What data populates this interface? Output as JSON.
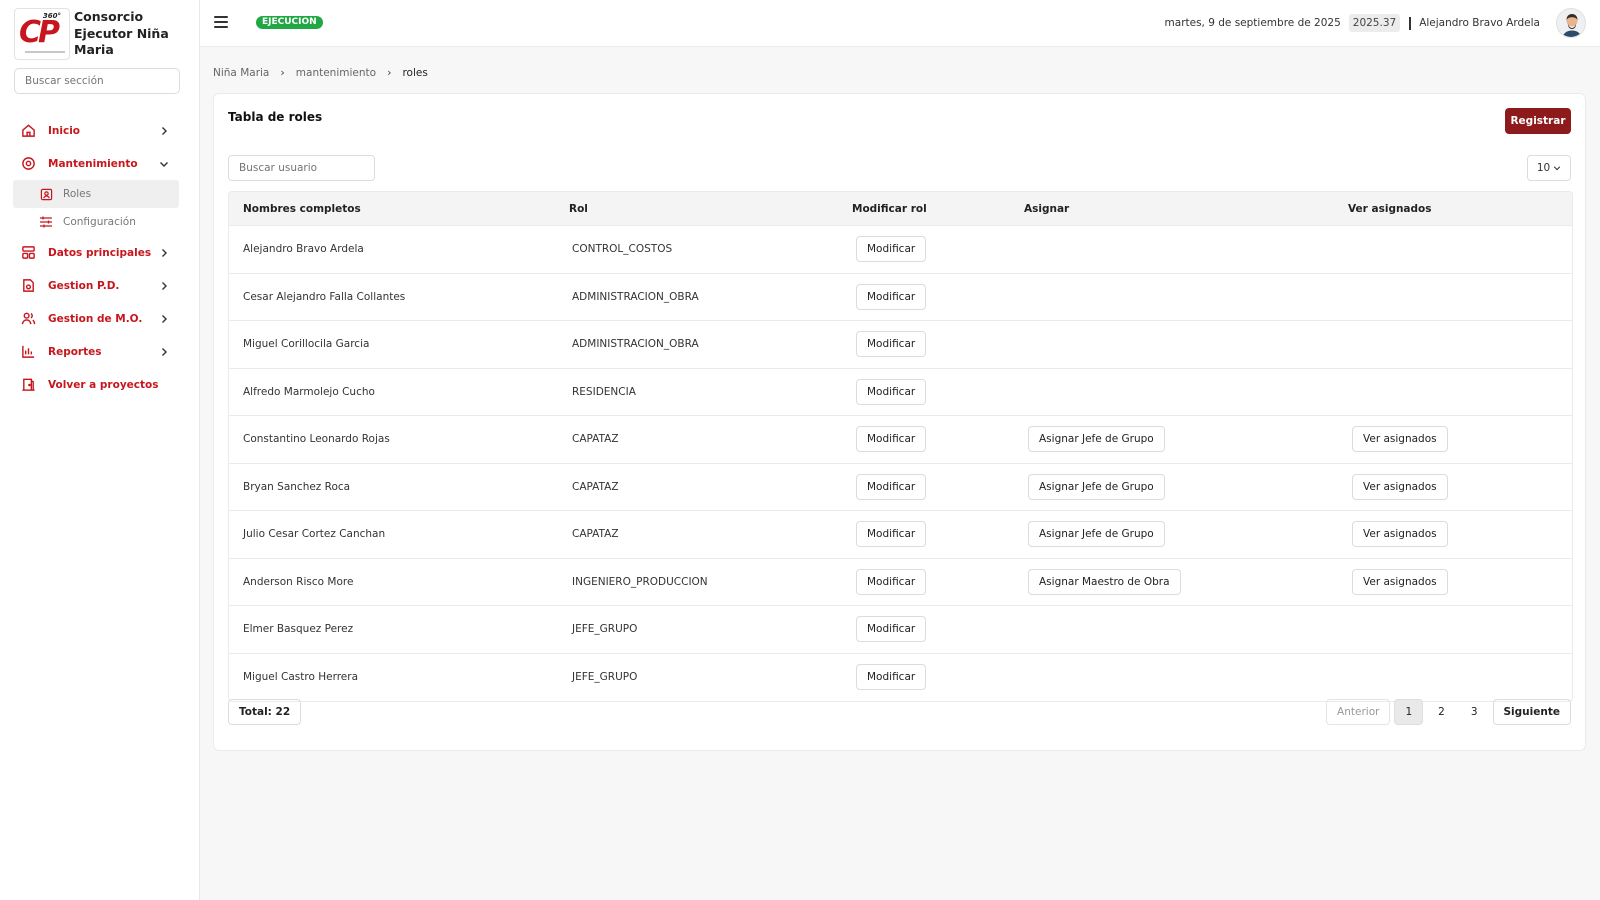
{
  "brand": {
    "name_line1": "Consorcio",
    "name_line2": "Ejecutor Niña",
    "name_line3": "Maria",
    "logo_text": "CP",
    "logo_badge": "360°"
  },
  "sidebar": {
    "search_placeholder": "Buscar sección",
    "items": [
      {
        "label": "Inicio",
        "icon": "home-icon",
        "chevron": "right"
      },
      {
        "label": "Mantenimiento",
        "icon": "settings-circle-icon",
        "chevron": "down"
      },
      {
        "label": "Datos principales",
        "icon": "layout-icon",
        "chevron": "right"
      },
      {
        "label": "Gestion P.D.",
        "icon": "document-gear-icon",
        "chevron": "right"
      },
      {
        "label": "Gestion de M.O.",
        "icon": "users-icon",
        "chevron": "right"
      },
      {
        "label": "Reportes",
        "icon": "bar-chart-icon",
        "chevron": "right"
      },
      {
        "label": "Volver a proyectos",
        "icon": "door-icon",
        "chevron": ""
      }
    ],
    "subitems": [
      {
        "label": "Roles",
        "icon": "id-badge-icon",
        "active": true
      },
      {
        "label": "Configuración",
        "icon": "sliders-icon",
        "active": false
      }
    ]
  },
  "topbar": {
    "status": "EJECUCION",
    "date": "martes, 9 de septiembre de 2025",
    "year": "2025.37",
    "user": "Alejandro Bravo Ardela"
  },
  "breadcrumb": [
    "Niña Maria",
    "mantenimiento",
    "roles"
  ],
  "card": {
    "title": "Tabla de roles",
    "register_label": "Registrar",
    "search_placeholder": "Buscar usuario",
    "page_size": "10"
  },
  "table": {
    "headers": [
      "Nombres completos",
      "Rol",
      "Modificar rol",
      "Asignar",
      "Ver asignados"
    ],
    "rows": [
      {
        "name": "Alejandro Bravo Ardela",
        "role": "CONTROL_COSTOS",
        "modify": "Modificar",
        "assign": "",
        "view": ""
      },
      {
        "name": "Cesar Alejandro Falla Collantes",
        "role": "ADMINISTRACION_OBRA",
        "modify": "Modificar",
        "assign": "",
        "view": ""
      },
      {
        "name": "Miguel Corillocila Garcia",
        "role": "ADMINISTRACION_OBRA",
        "modify": "Modificar",
        "assign": "",
        "view": ""
      },
      {
        "name": "Alfredo Marmolejo Cucho",
        "role": "RESIDENCIA",
        "modify": "Modificar",
        "assign": "",
        "view": ""
      },
      {
        "name": "Constantino Leonardo Rojas",
        "role": "CAPATAZ",
        "modify": "Modificar",
        "assign": "Asignar Jefe de Grupo",
        "view": "Ver asignados"
      },
      {
        "name": "Bryan Sanchez Roca",
        "role": "CAPATAZ",
        "modify": "Modificar",
        "assign": "Asignar Jefe de Grupo",
        "view": "Ver asignados"
      },
      {
        "name": "Julio Cesar Cortez Canchan",
        "role": "CAPATAZ",
        "modify": "Modificar",
        "assign": "Asignar Jefe de Grupo",
        "view": "Ver asignados"
      },
      {
        "name": "Anderson Risco More",
        "role": "INGENIERO_PRODUCCION",
        "modify": "Modificar",
        "assign": "Asignar Maestro de Obra",
        "view": "Ver asignados"
      },
      {
        "name": "Elmer Basquez Perez",
        "role": "JEFE_GRUPO",
        "modify": "Modificar",
        "assign": "",
        "view": ""
      },
      {
        "name": "Miguel Castro Herrera",
        "role": "JEFE_GRUPO",
        "modify": "Modificar",
        "assign": "",
        "view": ""
      }
    ]
  },
  "footer": {
    "total": "Total: 22",
    "prev": "Anterior",
    "pages": [
      "1",
      "2",
      "3"
    ],
    "current_page": "1",
    "next": "Siguiente"
  },
  "colors": {
    "accent": "#c7161d",
    "primary_button": "#8e1b1b",
    "status_green": "#22a745"
  }
}
